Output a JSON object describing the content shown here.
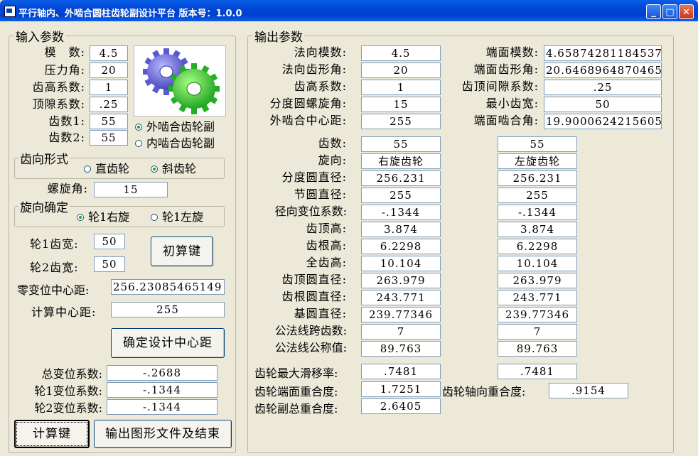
{
  "window": {
    "title": "平行轴内、外啮合圆柱齿轮副设计平台 版本号：1.0.0",
    "min": "_",
    "max": "□",
    "close": "✕"
  },
  "input": {
    "legend": "输入参数",
    "module_label": "模　数:",
    "module_value": "4.5",
    "pressure_label": "压力角:",
    "pressure_value": "20",
    "addendum_label": "齿高系数:",
    "addendum_value": "1",
    "clearance_label": "顶隙系数:",
    "clearance_value": ".25",
    "teeth1_label": "齿数1:",
    "teeth1_value": "55",
    "teeth2_label": "齿数2:",
    "teeth2_value": "55",
    "mesh_external": "外啮合齿轮副",
    "mesh_internal": "内啮合齿轮副",
    "tooth_form_legend": "齿向形式",
    "spur": "直齿轮",
    "helical": "斜齿轮",
    "helix_label": "螺旋角:",
    "helix_value": "15",
    "hand_legend": "旋向确定",
    "right_hand": "轮1右旋",
    "left_hand": "轮1左旋",
    "width1_label": "轮1齿宽:",
    "width1_value": "50",
    "width2_label": "轮2齿宽:",
    "width2_value": "50",
    "calc_init_button": "初算键",
    "zero_center_label": "零变位中心距:",
    "zero_center_value": "256.23085465149",
    "calc_center_label": "计算中心距:",
    "calc_center_value": "255",
    "confirm_center_button": "确定设计中心距",
    "total_shift_label": "总变位系数:",
    "total_shift_value": "-.2688",
    "shift1_label": "轮1变位系数:",
    "shift1_value": "-.1344",
    "shift2_label": "轮2变位系数:",
    "shift2_value": "-.1344",
    "compute_button": "计算键",
    "export_button": "输出图形文件及结束"
  },
  "output": {
    "legend": "输出参数",
    "normal_module_label": "法向模数:",
    "normal_module_value": "4.5",
    "normal_pa_label": "法向齿形角:",
    "normal_pa_value": "20",
    "addendum_label": "齿高系数:",
    "addendum_value": "1",
    "helix_label": "分度圆螺旋角:",
    "helix_value": "15",
    "center_label": "外啮合中心距:",
    "center_value": "255",
    "transverse_module_label": "端面模数:",
    "transverse_module_value": "4.65874281184537",
    "transverse_pa_label": "端面齿形角:",
    "transverse_pa_value": "20.6468964870465",
    "clearance_label": "齿顶间隙系数:",
    "clearance_value": ".25",
    "min_width_label": "最小齿宽:",
    "min_width_value": "50",
    "mesh_angle_label": "端面啮合角:",
    "mesh_angle_value": "19.9000624215605",
    "rows": [
      {
        "label": "齿数:",
        "g1": "55",
        "g2": "55"
      },
      {
        "label": "旋向:",
        "g1": "右旋齿轮",
        "g2": "左旋齿轮"
      },
      {
        "label": "分度圆直径:",
        "g1": "256.231",
        "g2": "256.231"
      },
      {
        "label": "节圆直径:",
        "g1": "255",
        "g2": "255"
      },
      {
        "label": "径向变位系数:",
        "g1": "-.1344",
        "g2": "-.1344"
      },
      {
        "label": "齿顶高:",
        "g1": "3.874",
        "g2": "3.874"
      },
      {
        "label": "齿根高:",
        "g1": "6.2298",
        "g2": "6.2298"
      },
      {
        "label": "全齿高:",
        "g1": "10.104",
        "g2": "10.104"
      },
      {
        "label": "齿顶圆直径:",
        "g1": "263.979",
        "g2": "263.979"
      },
      {
        "label": "齿根圆直径:",
        "g1": "243.771",
        "g2": "243.771"
      },
      {
        "label": "基圆直径:",
        "g1": "239.77346",
        "g2": "239.77346"
      },
      {
        "label": "公法线跨齿数:",
        "g1": "7",
        "g2": "7"
      },
      {
        "label": "公法线公称值:",
        "g1": "89.763",
        "g2": "89.763"
      }
    ],
    "slip_label": "齿轮最大滑移率:",
    "slip_g1": ".7481",
    "slip_g2": ".7481",
    "transverse_contact_label": "齿轮端面重合度:",
    "transverse_contact_value": "1.7251",
    "axial_contact_label": "齿轮轴向重合度:",
    "axial_contact_value": ".9154",
    "total_contact_label": "齿轮副总重合度:",
    "total_contact_value": "2.6405"
  }
}
